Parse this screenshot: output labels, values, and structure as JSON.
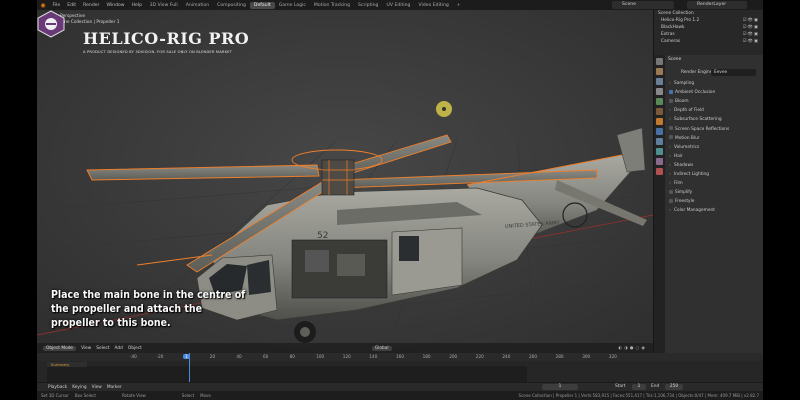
{
  "topbar": {
    "menus": [
      "File",
      "Edit",
      "Render",
      "Window",
      "Help"
    ],
    "workspaces": [
      "3D View Full",
      "Animation",
      "Compositing",
      "Default",
      "Game Logic",
      "Motion Tracking",
      "Scripting",
      "UV Editing",
      "Video Editing",
      "+"
    ],
    "active_workspace": "Default",
    "scene_name": "Scene",
    "view_layer": "RenderLayer"
  },
  "viewport": {
    "perspective_label": "User Perspective",
    "context_label": "(1) Scene Collection | Propeller 1",
    "logo_title": "HELICO-RIG PRO",
    "logo_subtitle": "A PRODUCT DESIGNED BY 3DVISION. FOR SALE ONLY ON BLENDER MARKET",
    "caption": "Place the main bone in the centre of the propeller and attach the propeller to this bone.",
    "fuselage_number": "52",
    "fuselage_text": "UNITED STATES ARMY",
    "header": {
      "mode": "Object Mode",
      "menus": [
        "View",
        "Select",
        "Add",
        "Object"
      ],
      "orientation": "Global"
    }
  },
  "outliner": {
    "title": "Scene Collection",
    "items": [
      "Helico-Rig Pro 1.2",
      "BlackHawk",
      "Extras",
      "Cameras"
    ]
  },
  "properties": {
    "header": "Scene",
    "render_engine_label": "Render Engine",
    "render_engine_value": "Eevee",
    "rows": [
      {
        "label": "Sampling",
        "type": "panel"
      },
      {
        "label": "Ambient Occlusion",
        "type": "check",
        "on": true
      },
      {
        "label": "Bloom",
        "type": "check",
        "on": false
      },
      {
        "label": "Depth of Field",
        "type": "panel"
      },
      {
        "label": "Subsurface Scattering",
        "type": "panel"
      },
      {
        "label": "Screen Space Reflections",
        "type": "check",
        "on": false
      },
      {
        "label": "Motion Blur",
        "type": "check",
        "on": false
      },
      {
        "label": "Volumetrics",
        "type": "panel"
      },
      {
        "label": "Hair",
        "type": "panel"
      },
      {
        "label": "Shadows",
        "type": "panel"
      },
      {
        "label": "Indirect Lighting",
        "type": "panel"
      },
      {
        "label": "Film",
        "type": "panel"
      },
      {
        "label": "Simplify",
        "type": "check",
        "on": false
      },
      {
        "label": "Freestyle",
        "type": "check",
        "on": false
      },
      {
        "label": "Color Management",
        "type": "panel"
      }
    ]
  },
  "timeline": {
    "ruler": [
      "-40",
      "-20",
      "1",
      "20",
      "40",
      "60",
      "80",
      "100",
      "120",
      "140",
      "160",
      "180",
      "200",
      "220",
      "240",
      "260",
      "280",
      "300",
      "320"
    ],
    "summary_label": "Summary",
    "current_frame": "1",
    "playback_menus": [
      "Playback",
      "Keying",
      "View",
      "Marker"
    ],
    "start_label": "Start",
    "start_value": "1",
    "end_label": "End",
    "end_value": "250"
  },
  "statusbar": {
    "hints": [
      "Set 3D Cursor",
      "Box Select",
      "Rotate View",
      "Select",
      "Move"
    ],
    "stats": "Scene Collection | Propeller 1 | Verts:583,915 | Faces:551,417 | Tris:1,106,734 | Objects:0/47 | Mem: 409.7 MiB | v2.82.7"
  },
  "colors": {
    "accent": "#4772b3",
    "brand_orange": "#e87d0d",
    "rig_orange": "#f07f2a",
    "cursor_yellow": "#d6c84a"
  }
}
